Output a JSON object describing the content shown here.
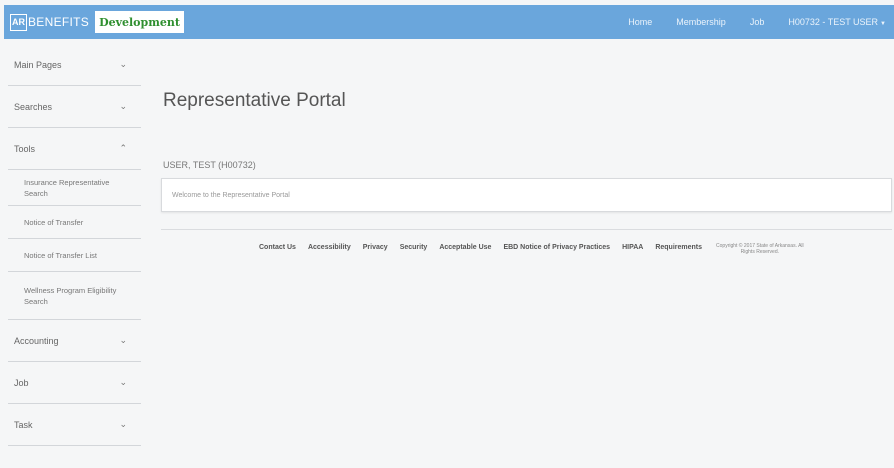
{
  "brand": {
    "logo_mark": "AR",
    "logo_text": "BENEFITS",
    "environment": "Development"
  },
  "nav": {
    "items": [
      "Home",
      "Membership",
      "Job"
    ],
    "user": "H00732 - TEST USER",
    "user_caret": "▼"
  },
  "sidebar": {
    "chevron_down": "⌄",
    "chevron_up": "⌃",
    "main_pages": "Main Pages",
    "searches": "Searches",
    "tools": "Tools",
    "tools_items": [
      "Insurance Representative Search",
      "Notice of Transfer",
      "Notice of Transfer List",
      "Wellness Program Eligibility Search"
    ],
    "accounting": "Accounting",
    "job": "Job",
    "task": "Task"
  },
  "main": {
    "title": "Representative Portal",
    "user_label": "USER, TEST (H00732)",
    "welcome": "Welcome to the Representative Portal"
  },
  "footer": {
    "links": [
      "Contact Us",
      "Accessibility",
      "Privacy",
      "Security",
      "Acceptable Use",
      "EBD Notice of Privacy Practices",
      "HIPAA",
      "Requirements"
    ],
    "copyright_line1": "Copyright © 2017 State of Arkansas. All",
    "copyright_line2": "Rights Reserved."
  }
}
